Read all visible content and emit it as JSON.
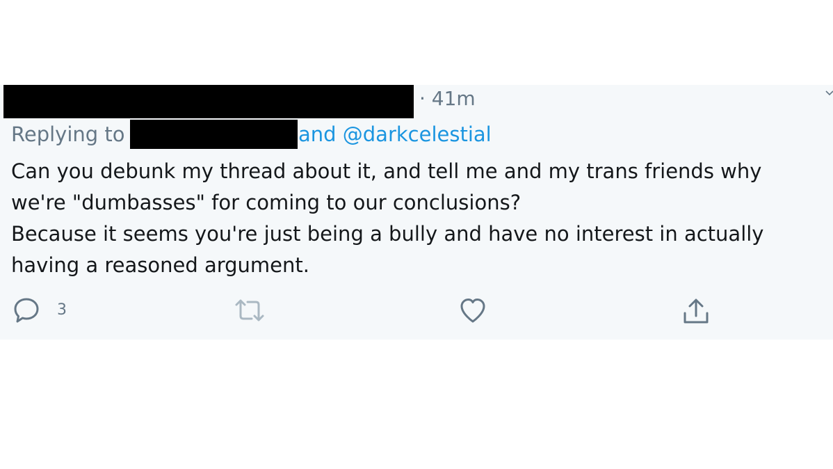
{
  "tweet": {
    "timestamp": "· 41m",
    "replying_prefix": "Replying to",
    "replying_mention": "and @darkcelestial",
    "body_lines": [
      "Can you debunk my thread about it, and tell me and my trans friends why",
      "we're \"dumbasses\" for coming to our conclusions?",
      "Because it seems you're just being a bully and have no interest in actually",
      "having a reasoned argument."
    ],
    "actions": {
      "reply_count": "3",
      "reply_icon": "reply-icon",
      "retweet_icon": "retweet-icon",
      "like_icon": "heart-icon",
      "share_icon": "share-icon"
    },
    "colors": {
      "background": "#f5f8fa",
      "secondary_text": "#657786",
      "link": "#1b95e0",
      "primary_text": "#14171a"
    }
  }
}
